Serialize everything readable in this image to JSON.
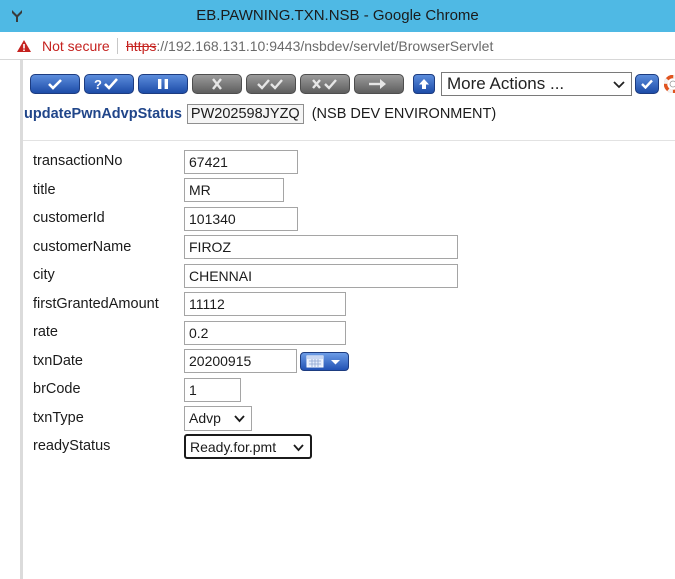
{
  "window": {
    "title": "EB.PAWNING.TXN.NSB - Google Chrome"
  },
  "address_bar": {
    "security_label": "Not secure",
    "url_scheme": "https",
    "url_rest": "://192.168.131.10:9443/nsbdev/servlet/BrowserServlet"
  },
  "toolbar": {
    "buttons": [
      {
        "name": "commit-button",
        "icon": "check-icon",
        "state": "active"
      },
      {
        "name": "validate-button",
        "icon": "question-check-icon",
        "state": "active"
      },
      {
        "name": "hold-button",
        "icon": "pause-icon",
        "state": "active"
      },
      {
        "name": "delete-button",
        "icon": "x-icon",
        "state": "disabled"
      },
      {
        "name": "authorise-button",
        "icon": "double-check-icon",
        "state": "disabled"
      },
      {
        "name": "reverse-button",
        "icon": "x-check-icon",
        "state": "disabled"
      },
      {
        "name": "next-button",
        "icon": "arrow-right-icon",
        "state": "disabled"
      },
      {
        "name": "upload-button",
        "icon": "arrow-up-icon",
        "state": "active"
      }
    ],
    "more_actions": "More Actions ...",
    "help_icon": "lifebuoy-icon"
  },
  "header": {
    "application": "updatePwnAdvpStatus",
    "record_id": "PW202598JYZQ",
    "environment": "(NSB DEV ENVIRONMENT)"
  },
  "form": {
    "fields": [
      {
        "label": "transactionNo",
        "value": "67421"
      },
      {
        "label": "title",
        "value": "MR"
      },
      {
        "label": "customerId",
        "value": "101340"
      },
      {
        "label": "customerName",
        "value": "FIROZ"
      },
      {
        "label": "city",
        "value": "CHENNAI"
      },
      {
        "label": "firstGrantedAmount",
        "value": "11112"
      },
      {
        "label": "rate",
        "value": "0.2"
      },
      {
        "label": "txnDate",
        "value": "20200915"
      },
      {
        "label": "brCode",
        "value": "1"
      },
      {
        "label": "txnType",
        "value": "Advp"
      },
      {
        "label": "readyStatus",
        "value": "Ready.for.pmt"
      }
    ]
  },
  "colors": {
    "titlebar": "#4fb9e4",
    "button_active": "#1d4ca8",
    "button_disabled": "#5e5e5e",
    "not_secure": "#c5221f",
    "app_name": "#21468a"
  }
}
